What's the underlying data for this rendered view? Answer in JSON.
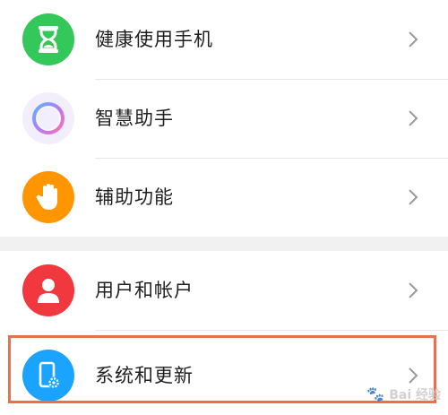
{
  "settings_group_1": [
    {
      "label": "健康使用手机",
      "icon": "hourglass-icon",
      "color": "#34c759"
    },
    {
      "label": "智慧助手",
      "icon": "smart-assistant-ring-icon",
      "color": "#a98df0"
    },
    {
      "label": "辅助功能",
      "icon": "hand-icon",
      "color": "#ff9500"
    }
  ],
  "settings_group_2": [
    {
      "label": "用户和帐户",
      "icon": "user-icon",
      "color": "#f0383e"
    },
    {
      "label": "系统和更新",
      "icon": "phone-settings-icon",
      "color": "#1aa3ff"
    }
  ],
  "watermark": {
    "text": "Bai 经验",
    "paw": "🐾"
  },
  "highlight_color": "#e8704a"
}
